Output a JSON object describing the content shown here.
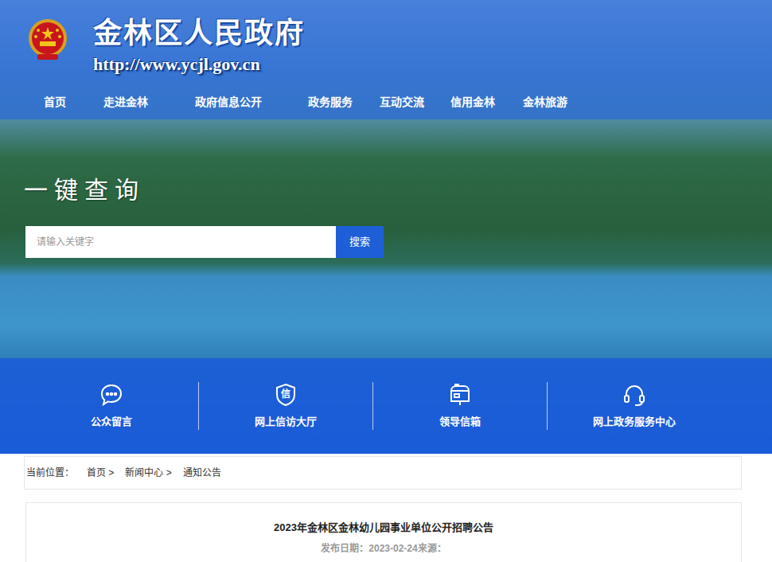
{
  "site": {
    "title": "金林区人民政府",
    "url": "http://www.ycjl.gov.cn"
  },
  "nav": [
    "首页",
    "走进金林",
    "政府信息公开",
    "政务服务",
    "互动交流",
    "信用金林",
    "金林旅游"
  ],
  "search": {
    "heading": "一键查询",
    "placeholder": "请输入关键字",
    "button": "搜索"
  },
  "quick_links": [
    {
      "label": "公众留言",
      "kind": "message"
    },
    {
      "label": "网上信访大厅",
      "kind": "petition",
      "icon_text": "信"
    },
    {
      "label": "领导信箱",
      "kind": "mailbox"
    },
    {
      "label": "网上政务服务中心",
      "kind": "service"
    }
  ],
  "breadcrumb": {
    "label": "当前位置：",
    "items": [
      "首页 >",
      "新闻中心 >",
      "通知公告"
    ]
  },
  "article": {
    "title": "2023年金林区金林幼儿园事业单位公开招聘公告",
    "meta": "发布日期：2023-02-24来源："
  }
}
